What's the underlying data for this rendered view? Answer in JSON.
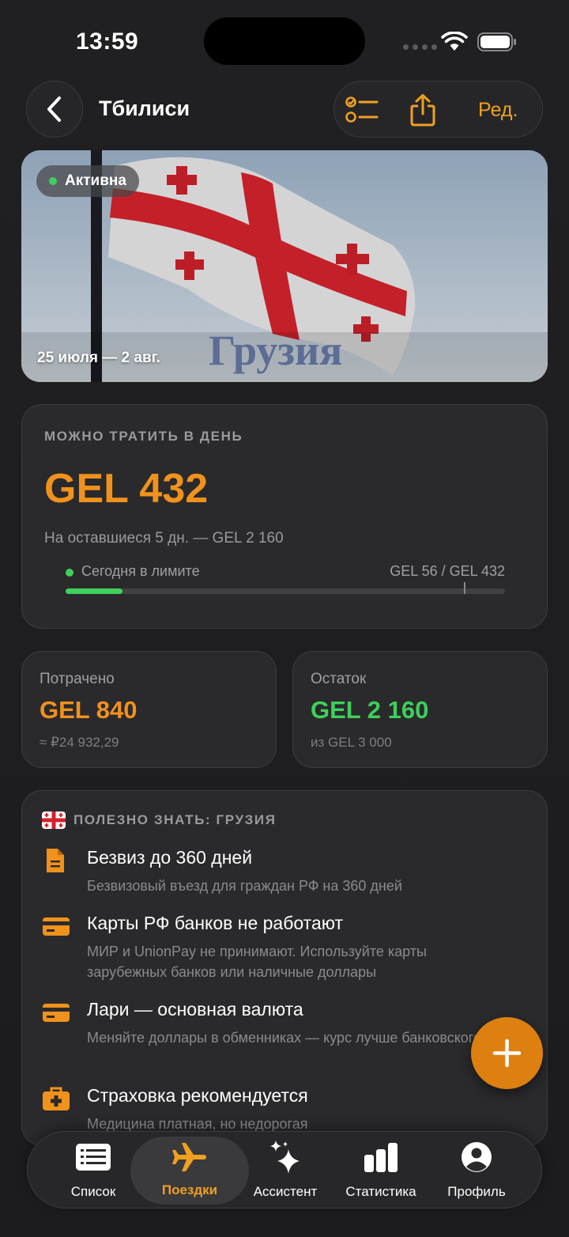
{
  "status_bar": {
    "time": "13:59"
  },
  "nav": {
    "title": "Тбилиси",
    "edit_label": "Ред."
  },
  "hero": {
    "status": "Активна",
    "dates": "25 июля — 2 авг.",
    "country": "Грузия"
  },
  "daily": {
    "label": "МОЖНО ТРАТИТЬ В ДЕНЬ",
    "amount": "GEL 432",
    "remaining": "На оставшиеся 5 дн. — GEL 2 160",
    "limit_label": "Сегодня в лимите",
    "limit_value": "GEL 56 / GEL 432",
    "progress_fraction": 0.1296
  },
  "spent": {
    "label": "Потрачено",
    "amount": "GEL 840",
    "sub": "≈ ₽24 932,29"
  },
  "rest": {
    "label": "Остаток",
    "amount": "GEL 2 160",
    "sub": "из GEL 3 000"
  },
  "info": {
    "heading": "ПОЛЕЗНО ЗНАТЬ: ГРУЗИЯ",
    "items": [
      {
        "icon": "document-icon",
        "title": "Безвиз до 360 дней",
        "desc": "Безвизовый въезд для граждан РФ на 360 дней"
      },
      {
        "icon": "credit-card-icon",
        "title": "Карты РФ банков не работают",
        "desc": "МИР и UnionPay не принимают. Используйте карты зарубежных банков или наличные доллары"
      },
      {
        "icon": "credit-card-icon",
        "title": "Лари — основная валюта",
        "desc": "Меняйте доллары в обменниках — курс лучше банковского"
      },
      {
        "icon": "medical-kit-icon",
        "title": "Страховка рекомендуется",
        "desc": "Медицина платная, но недорогая"
      }
    ]
  },
  "tabs": [
    {
      "label": "Список",
      "icon": "list-icon"
    },
    {
      "label": "Поездки",
      "icon": "airplane-icon",
      "active": true
    },
    {
      "label": "Ассистент",
      "icon": "sparkles-icon"
    },
    {
      "label": "Статистика",
      "icon": "bar-chart-icon"
    },
    {
      "label": "Профиль",
      "icon": "person-icon"
    }
  ],
  "colors": {
    "accent": "#f0921c",
    "positive": "#3ed05a",
    "background": "#1f1f21",
    "card": "#2a2a2c"
  }
}
